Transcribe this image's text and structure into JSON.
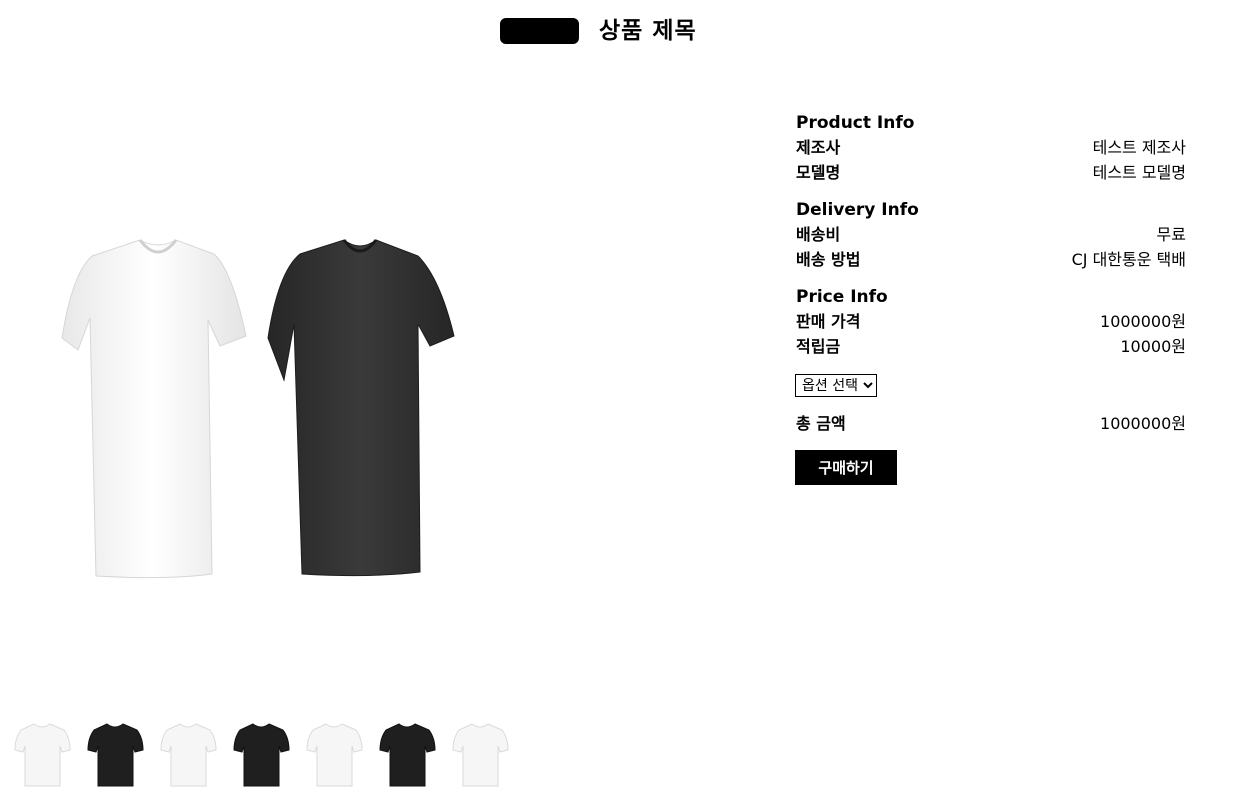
{
  "header": {
    "title": "상품 제목"
  },
  "product_info": {
    "title": "Product Info",
    "manufacturer_label": "제조사",
    "manufacturer_value": "테스트 제조사",
    "model_label": "모델명",
    "model_value": "테스트 모델명"
  },
  "delivery_info": {
    "title": "Delivery Info",
    "fee_label": "배송비",
    "fee_value": "무료",
    "method_label": "배송 방법",
    "method_value": "CJ 대한통운 택배"
  },
  "price_info": {
    "title": "Price Info",
    "price_label": "판매 가격",
    "price_value": "1000000원",
    "points_label": "적립금",
    "points_value": "10000원"
  },
  "option_select": {
    "selected": "옵션 선택"
  },
  "total": {
    "label": "총 금액",
    "value": "1000000원"
  },
  "buy_button": {
    "label": "구매하기"
  },
  "colors": {
    "brand": "#000000",
    "shirt_white": "#f4f4f4",
    "shirt_black": "#2b2b2b"
  },
  "thumbnails": [
    "white-tshirt",
    "black-tshirt",
    "white-tshirt",
    "black-tshirt",
    "white-tshirt",
    "black-tshirt",
    "white-tshirt"
  ]
}
